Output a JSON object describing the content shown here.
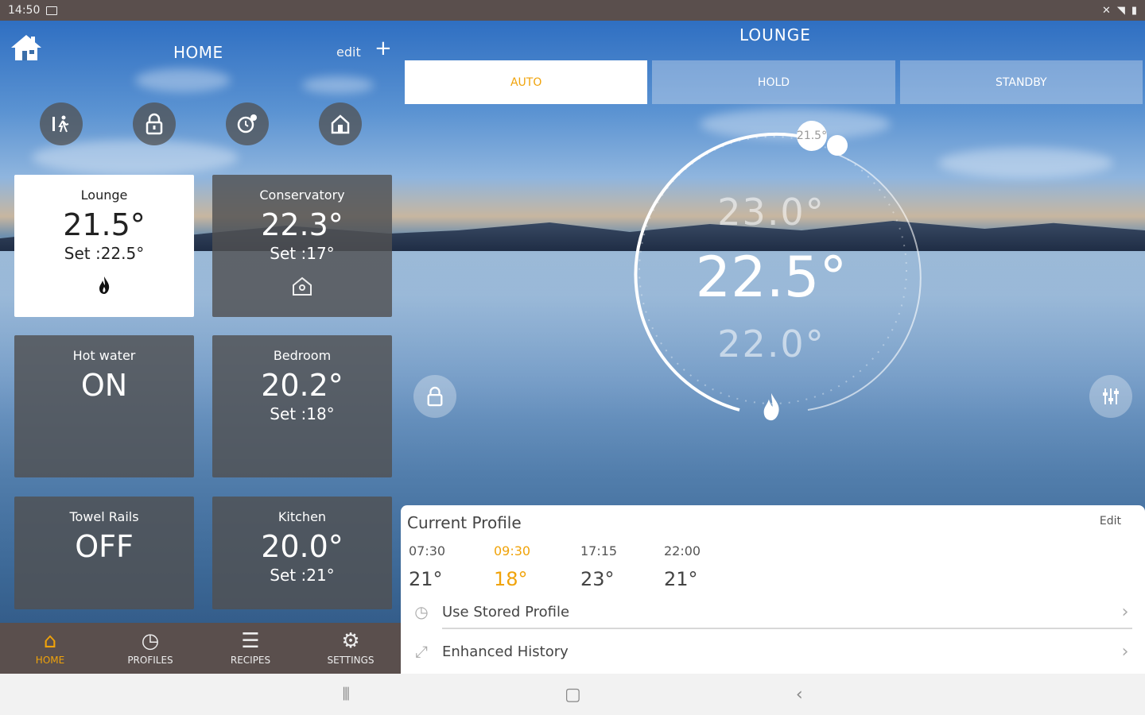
{
  "status_bar": {
    "time": "14:50",
    "right_icons": [
      "mute-icon",
      "wifi-icon",
      "battery-icon"
    ]
  },
  "left_header": {
    "title": "HOME",
    "edit_label": "edit",
    "add_label": "+"
  },
  "quick_actions": [
    {
      "name": "away-mode-button",
      "icon": "walking-person-icon"
    },
    {
      "name": "lock-button",
      "icon": "lock-icon"
    },
    {
      "name": "boost-button",
      "icon": "timer-icon"
    },
    {
      "name": "home-mode-button",
      "icon": "house-icon"
    }
  ],
  "zones": [
    {
      "name": "Lounge",
      "temp": "21.5°",
      "set": "Set :22.5°",
      "icon": "flame-icon",
      "icon_glyph": "🔥",
      "active": true
    },
    {
      "name": "Conservatory",
      "temp": "22.3°",
      "set": "Set :17°",
      "icon": "house-icon",
      "icon_glyph": "⌂",
      "active": false
    },
    {
      "name": "Hot water",
      "temp": "ON",
      "set": "",
      "active": false
    },
    {
      "name": "Bedroom",
      "temp": "20.2°",
      "set": "Set :18°",
      "active": false
    },
    {
      "name": "Towel Rails",
      "temp": "OFF",
      "set": "",
      "active": false
    },
    {
      "name": "Kitchen",
      "temp": "20.0°",
      "set": "Set :21°",
      "active": false
    }
  ],
  "bottom_nav": [
    {
      "label": "HOME",
      "icon": "home-icon",
      "active": true
    },
    {
      "label": "PROFILES",
      "icon": "clock-icon",
      "active": false
    },
    {
      "label": "RECIPES",
      "icon": "list-icon",
      "active": false
    },
    {
      "label": "SETTINGS",
      "icon": "gear-icon",
      "active": false
    }
  ],
  "zone_detail": {
    "title": "LOUNGE",
    "modes": [
      "AUTO",
      "HOLD",
      "STANDBY"
    ],
    "active_mode": "AUTO",
    "dial": {
      "up_temp": "23.0°",
      "current_setpoint": "22.5°",
      "down_temp": "22.0°",
      "marker": "21.5°"
    }
  },
  "profile": {
    "title": "Current Profile",
    "edit_label": "Edit",
    "slots": [
      {
        "time": "07:30",
        "temp": "21°",
        "current": false
      },
      {
        "time": "09:30",
        "temp": "18°",
        "current": true
      },
      {
        "time": "17:15",
        "temp": "23°",
        "current": false
      },
      {
        "time": "22:00",
        "temp": "21°",
        "current": false
      }
    ],
    "rows": [
      {
        "label": "Use Stored Profile",
        "icon": "clock-icon"
      },
      {
        "label": "Enhanced History",
        "icon": "expand-icon"
      }
    ]
  },
  "colors": {
    "accent": "#f0a30a",
    "bar": "#5a4f4d",
    "tile": "#505052"
  }
}
